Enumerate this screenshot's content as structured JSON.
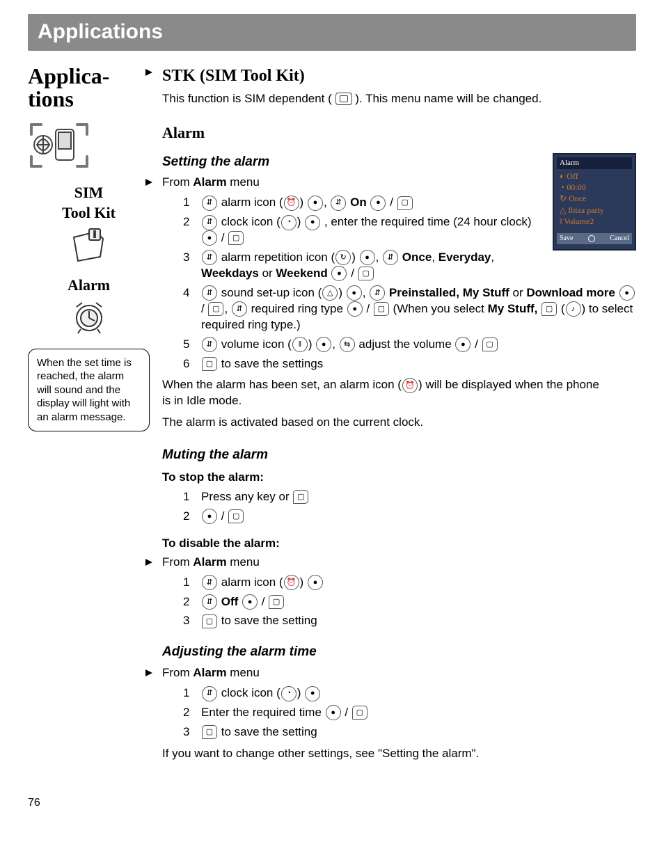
{
  "header": "Applications",
  "sidebar": {
    "title_line1": "Applica-",
    "title_line2": "tions",
    "sim_label": "SIM",
    "toolkit_label": "Tool Kit",
    "alarm_label": "Alarm",
    "note": "When the set time is reached, the alarm will sound and the display will light with an alarm message."
  },
  "stk": {
    "title": "STK (SIM Tool Kit)",
    "body_a": "This function is SIM dependent (",
    "body_b": "). This menu name will be changed."
  },
  "alarm": {
    "title": "Alarm",
    "setting_h": "Setting the alarm",
    "from_a": "From ",
    "menu_word": "Alarm",
    "from_c": " menu",
    "s1_a": "alarm icon (",
    "s1_b": ") ",
    "s1_c": ", ",
    "s1_on": "On",
    "s1_d": " ",
    "s1_e": " / ",
    "s2_a": "clock icon (",
    "s2_b": ") ",
    "s2_c": ", enter the required time (24 hour clock) ",
    "s2_d": " / ",
    "s3_a": "alarm repetition icon (",
    "s3_b": ") ",
    "s3_c": ", ",
    "s3_once": "Once",
    "s3_every": "Everyday",
    "s3_wd": "Weekdays",
    "s3_or": " or ",
    "s3_we": "Weekend",
    "s3_d": " ",
    "s3_e": " / ",
    "s4_a": "sound set-up icon (",
    "s4_b": ") ",
    "s4_c": ", ",
    "s4_pre": "Preinstalled, My Stuff",
    "s4_or": " or ",
    "s4_dl": "Download more",
    "s4_d": " ",
    "s4_e": " / ",
    "s4_f": ", ",
    "s4_g": " required ring type ",
    "s4_h": " / ",
    "s4_i": " (When you select ",
    "s4_ms": "My Stuff,",
    "s4_j": " ",
    "s4_k": " (",
    "s4_l": ") to select required ring type.)",
    "s5_a": "volume icon (",
    "s5_b": ") ",
    "s5_c": ", ",
    "s5_d": " adjust the volume ",
    "s5_e": " / ",
    "s6_a": " to save the settings",
    "post1": "When the alarm has been set, an alarm icon (",
    "post1b": ") will be displayed when the phone is in Idle mode.",
    "post2": "The alarm is activated based on the current clock.",
    "muting_h": "Muting the alarm",
    "stop_h": "To stop the alarm:",
    "m1_a": "Press any key or ",
    "m2_a": " / ",
    "disable_h": "To disable the alarm:",
    "d1_a": "alarm icon (",
    "d1_b": ") ",
    "d2_off": "Off",
    "d2_a": " ",
    "d2_b": " / ",
    "d3_a": " to save the setting",
    "adjust_h": "Adjusting the alarm time",
    "a1_a": "clock icon (",
    "a1_b": ") ",
    "a2_a": "Enter the required time ",
    "a2_b": " / ",
    "a3_a": " to save the setting",
    "tail": "If you want to change other settings, see \"Setting the alarm\"."
  },
  "phone": {
    "title": "Alarm",
    "l1": "Off",
    "l2": "00:00",
    "l3": "Once",
    "l4": "Ibiza party",
    "l5": "Volume2",
    "save": "Save",
    "cancel": "Cancel"
  },
  "pagenum": "76"
}
